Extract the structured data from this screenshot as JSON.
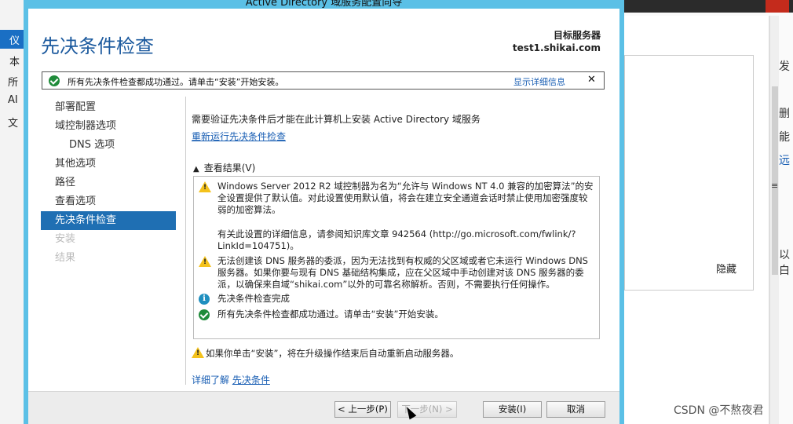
{
  "background_app": {
    "left_nav": [
      "仪",
      "本",
      "所",
      "AI",
      "文"
    ],
    "right_edge": [
      "发",
      "删",
      "能",
      "远",
      "≡",
      "以白"
    ],
    "hide_label": "隐藏"
  },
  "watermark": "CSDN @不熬夜君",
  "dialog": {
    "window_title": "Active Directory 域服务配置向导",
    "page_title": "先决条件检查",
    "target_label": "目标服务器",
    "target_server": "test1.shikai.com",
    "banner": {
      "text": "所有先决条件检查都成功通过。请单击“安装”开始安装。",
      "details_link": "显示详细信息",
      "close": "✕"
    },
    "nav": [
      {
        "label": "部署配置",
        "state": "normal"
      },
      {
        "label": "域控制器选项",
        "state": "normal"
      },
      {
        "label": "DNS 选项",
        "state": "sub"
      },
      {
        "label": "其他选项",
        "state": "normal"
      },
      {
        "label": "路径",
        "state": "normal"
      },
      {
        "label": "查看选项",
        "state": "normal"
      },
      {
        "label": "先决条件检查",
        "state": "active"
      },
      {
        "label": "安装",
        "state": "disabled"
      },
      {
        "label": "结果",
        "state": "disabled"
      }
    ],
    "description": "需要验证先决条件后才能在此计算机上安装 Active Directory 域服务",
    "rerun_link": "重新运行先决条件检查",
    "results_header": "查看结果(V)",
    "results": [
      {
        "icon": "warning",
        "text": "Windows Server 2012 R2 域控制器为名为“允许与 Windows NT 4.0 兼容的加密算法”的安全设置提供了默认值。对此设置使用默认值，将会在建立安全通道会话时禁止使用加密强度较弱的加密算法。"
      },
      {
        "icon": "none",
        "text": "有关此设置的详细信息，请参阅知识库文章 942564 (http://go.microsoft.com/fwlink/?LinkId=104751)。"
      },
      {
        "icon": "warning",
        "text": "无法创建该 DNS 服务器的委派，因为无法找到有权威的父区域或者它未运行 Windows DNS 服务器。如果你要与现有 DNS 基础结构集成，应在父区域中手动创建对该 DNS 服务器的委派，以确保来自域“shikai.com”以外的可靠名称解析。否则，不需要执行任何操作。"
      },
      {
        "icon": "info",
        "text": "先决条件检查完成"
      },
      {
        "icon": "ok",
        "text": "所有先决条件检查都成功通过。请单击“安装”开始安装。"
      }
    ],
    "footer_warning": "如果你单击“安装”，将在升级操作结束后自动重新启动服务器。",
    "learn_more_prefix": "详细了解",
    "learn_more_link": "先决条件",
    "buttons": {
      "prev": "< 上一步(P)",
      "next": "下一步(N) >",
      "install": "安装(I)",
      "cancel": "取消"
    }
  }
}
